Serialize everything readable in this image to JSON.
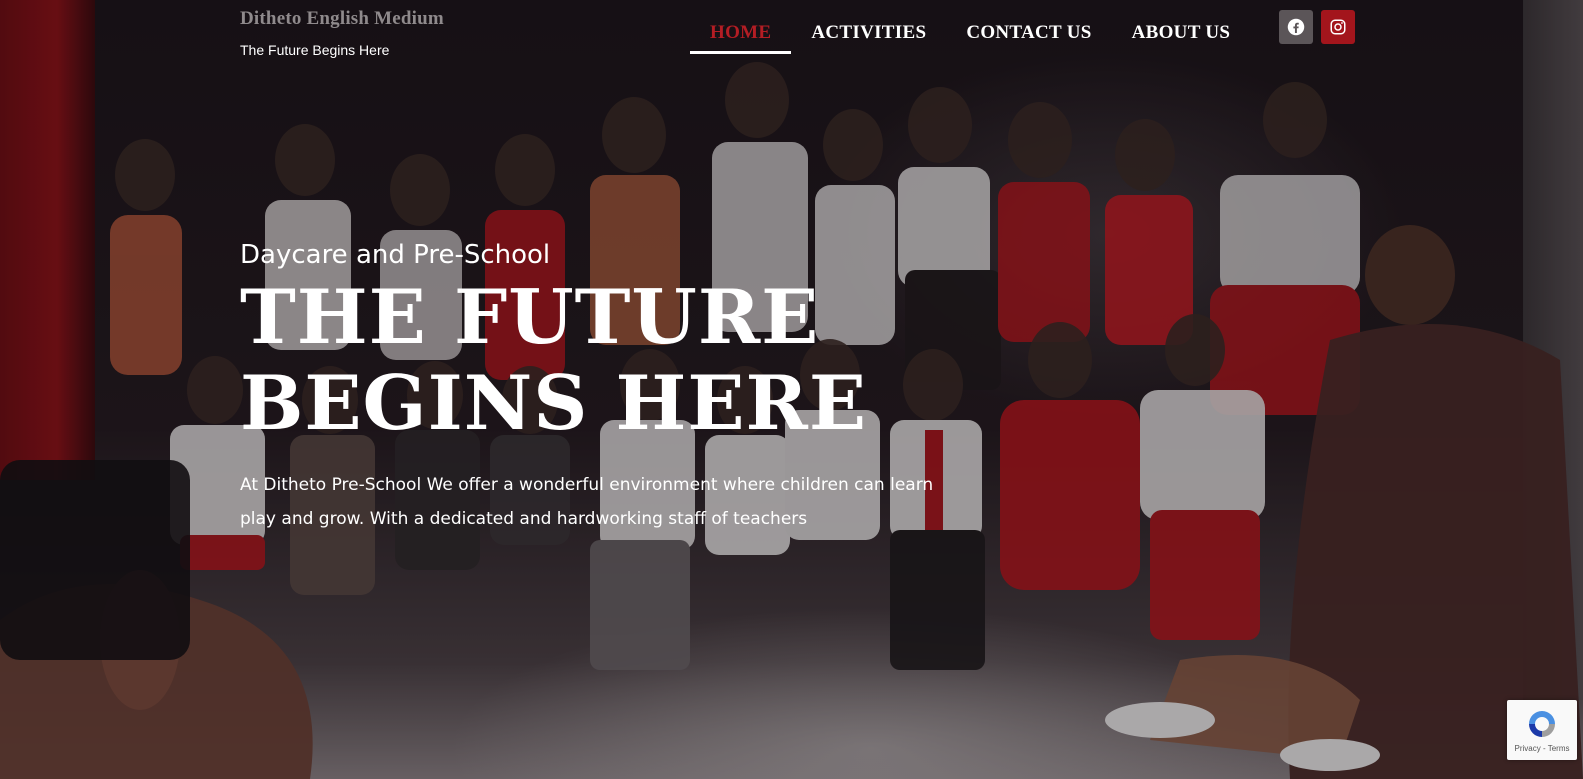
{
  "header": {
    "site_title": "Ditheto English Medium",
    "tagline": "The Future Begins Here",
    "nav": [
      {
        "label": "HOME",
        "active": true
      },
      {
        "label": "ACTIVITIES",
        "active": false
      },
      {
        "label": "CONTACT US",
        "active": false
      },
      {
        "label": "ABOUT US",
        "active": false
      }
    ],
    "social": [
      {
        "name": "facebook-icon"
      },
      {
        "name": "instagram-icon"
      }
    ]
  },
  "hero": {
    "subtitle": "Daycare and Pre-School",
    "heading_line1": "THE FUTURE",
    "heading_line2": "BEGINS HERE",
    "description": "At Ditheto Pre-School We offer a wonderful environment where children can learn play and grow. With a dedicated and hardworking staff of teachers"
  },
  "recaptcha": {
    "links": "Privacy - Terms"
  },
  "colors": {
    "accent_red": "#b41d24",
    "text_white": "#ffffff",
    "title_gray": "#8f8a8c"
  }
}
